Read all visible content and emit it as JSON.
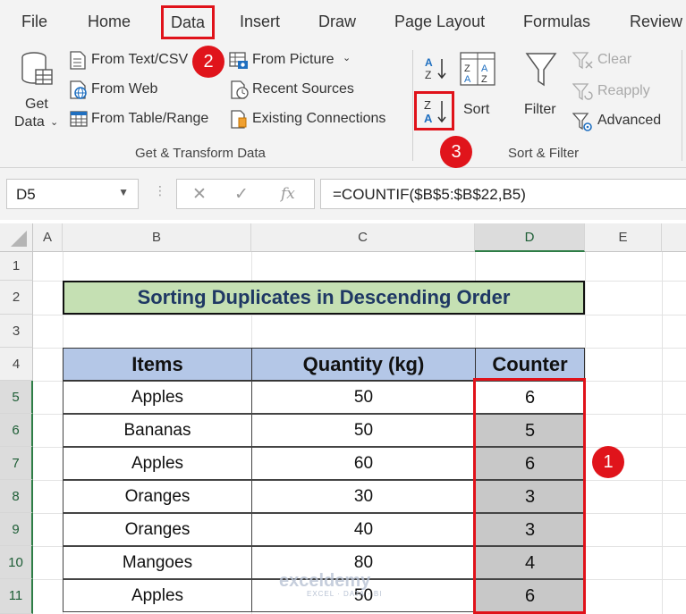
{
  "ribbon_tabs": [
    "File",
    "Home",
    "Data",
    "Insert",
    "Draw",
    "Page Layout",
    "Formulas",
    "Review"
  ],
  "get_transform": {
    "get_data_line1": "Get",
    "get_data_line2": "Data",
    "from_text_csv": "From Text/CSV",
    "from_web": "From Web",
    "from_table_range": "From Table/Range",
    "from_picture": "From Picture",
    "recent_sources": "Recent Sources",
    "existing_connections": "Existing Connections",
    "group_label": "Get & Transform Data"
  },
  "sort_filter": {
    "sort": "Sort",
    "filter": "Filter",
    "clear": "Clear",
    "reapply": "Reapply",
    "advanced": "Advanced",
    "group_label": "Sort & Filter"
  },
  "badges": {
    "b1": "1",
    "b2": "2",
    "b3": "3"
  },
  "formula_bar": {
    "name_box": "D5",
    "formula": "=COUNTIF($B$5:$B$22,B5)",
    "fx": "fx"
  },
  "columns": [
    "A",
    "B",
    "C",
    "D",
    "E"
  ],
  "rows": [
    "1",
    "2",
    "3",
    "4",
    "5",
    "6",
    "7",
    "8",
    "9",
    "10",
    "11"
  ],
  "sheet": {
    "title": "Sorting Duplicates in Descending Order",
    "headers": [
      "Items",
      "Quantity (kg)",
      "Counter"
    ],
    "data_rows": [
      [
        "Apples",
        "50",
        "6"
      ],
      [
        "Bananas",
        "50",
        "5"
      ],
      [
        "Apples",
        "60",
        "6"
      ],
      [
        "Oranges",
        "30",
        "3"
      ],
      [
        "Oranges",
        "40",
        "3"
      ],
      [
        "Mangoes",
        "80",
        "4"
      ],
      [
        "Apples",
        "50",
        "6"
      ]
    ]
  },
  "watermark": {
    "name": "exceldemy",
    "tagline": "EXCEL · DATA · BI"
  },
  "colors": {
    "highlight_red": "#e0121a",
    "title_fill": "#c5e0b3",
    "header_fill": "#b4c7e7",
    "counter_fill": "#c8c8c8",
    "selection_green": "#2e7d46"
  }
}
